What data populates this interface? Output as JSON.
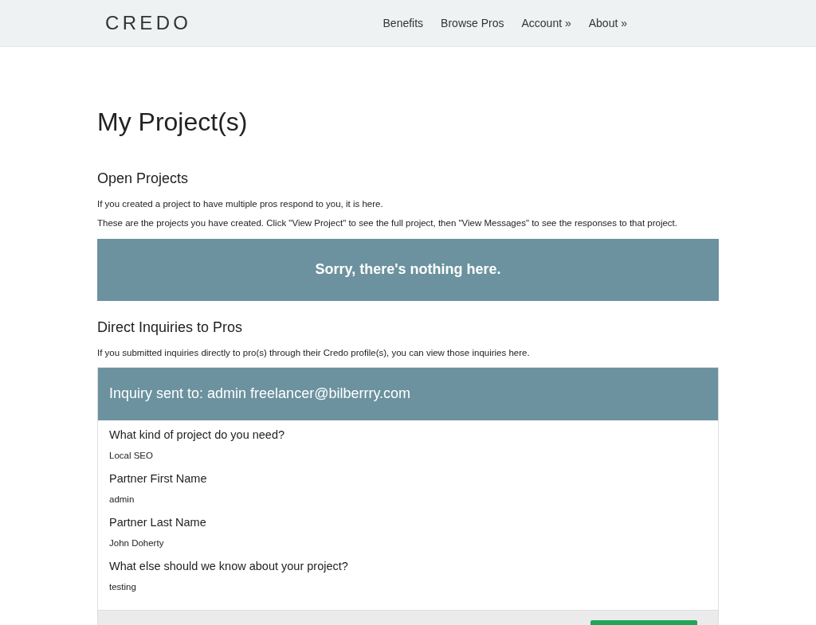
{
  "header": {
    "logo": "CREDO",
    "nav": [
      {
        "label": "Benefits"
      },
      {
        "label": "Browse Pros"
      },
      {
        "label": "Account »"
      },
      {
        "label": "About »"
      }
    ]
  },
  "page_title": "My Project(s)",
  "open_projects": {
    "heading": "Open Projects",
    "paragraphs": [
      "If you created a project to have multiple pros respond to you, it is here.",
      "These are the projects you have created. Click \"View Project\" to see the full project, then \"View Messages\" to see the responses to that project."
    ],
    "empty_message": "Sorry, there's nothing here."
  },
  "direct_inquiries": {
    "heading": "Direct Inquiries to Pros",
    "paragraph": "If you submitted inquiries directly to pro(s) through their Credo profile(s), you can view those inquiries here.",
    "inquiry": {
      "title": "Inquiry sent to: admin freelancer@bilberrry.com",
      "fields": [
        {
          "label": "What kind of project do you need?",
          "value": "Local SEO"
        },
        {
          "label": "Partner First Name",
          "value": "admin"
        },
        {
          "label": "Partner Last Name",
          "value": "John Doherty"
        },
        {
          "label": "What else should we know about your project?",
          "value": "testing"
        }
      ]
    }
  }
}
